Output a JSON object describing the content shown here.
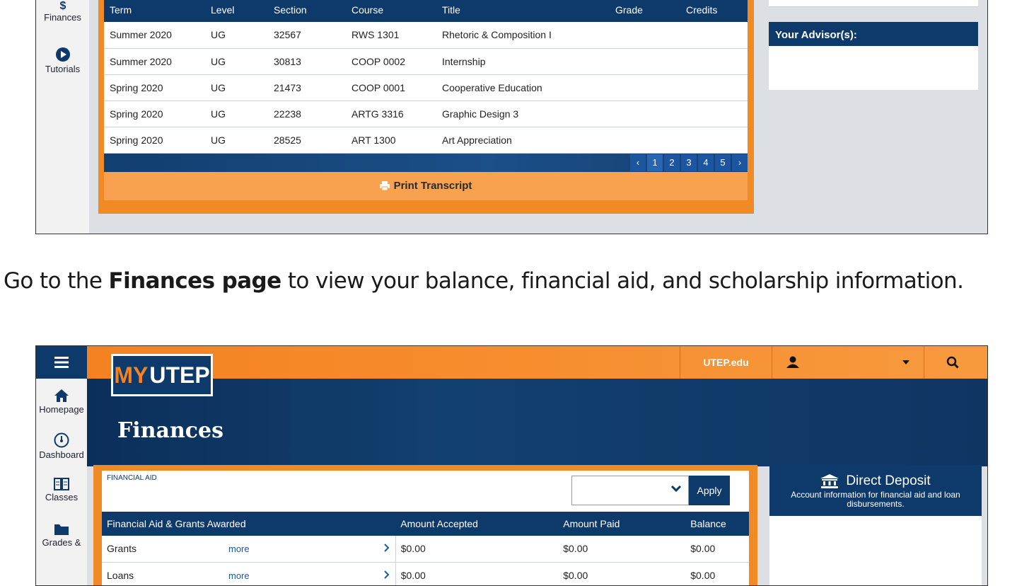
{
  "transcript_shot": {
    "rail": [
      {
        "label": "Finances",
        "icon": "dollar-icon"
      },
      {
        "label": "Tutorials",
        "icon": "play-icon"
      }
    ],
    "headers": [
      "Term",
      "Level",
      "Section",
      "Course",
      "Title",
      "Grade",
      "Credits"
    ],
    "rows": [
      [
        "Summer 2020",
        "UG",
        "32567",
        "RWS 1301",
        "Rhetoric & Composition I",
        "",
        ""
      ],
      [
        "Summer 2020",
        "UG",
        "30813",
        "COOP 0002",
        "Internship",
        "",
        ""
      ],
      [
        "Spring 2020",
        "UG",
        "21473",
        "COOP 0001",
        "Cooperative Education",
        "",
        ""
      ],
      [
        "Spring 2020",
        "UG",
        "22238",
        "ARTG 3316",
        "Graphic Design 3",
        "",
        ""
      ],
      [
        "Spring 2020",
        "UG",
        "28525",
        "ART 1300",
        "Art Appreciation",
        "",
        ""
      ]
    ],
    "pager": {
      "prev": "‹",
      "pages": [
        "1",
        "2",
        "3",
        "4",
        "5"
      ],
      "next": "›",
      "current": "1"
    },
    "print_label": "Print Transcript",
    "advisor_title": "Your Advisor(s):"
  },
  "caption": {
    "before": "Go to the ",
    "bold": "Finances page",
    "after": " to view your balance, financial aid, and scholarship information."
  },
  "finances_shot": {
    "logo": {
      "my": "MY",
      "utep": "UTEP"
    },
    "topbar": {
      "link": "UTEP.edu"
    },
    "sidebar": [
      {
        "label": "Homepage",
        "icon": "home-icon"
      },
      {
        "label": "Dashboard",
        "icon": "dashboard-icon"
      },
      {
        "label": "Classes",
        "icon": "book-icon"
      },
      {
        "label": "Grades &",
        "icon": "folder-icon"
      }
    ],
    "page_title": "Finances",
    "financial_aid": {
      "label": "FINANCIAL AID",
      "select_value": "",
      "apply_label": "Apply",
      "headers": [
        "Financial Aid & Grants Awarded",
        "Amount Accepted",
        "Amount Paid",
        "Balance"
      ],
      "rows": [
        {
          "name": "Grants",
          "more": "more",
          "accepted": "$0.00",
          "paid": "$0.00",
          "balance": "$0.00"
        },
        {
          "name": "Loans",
          "more": "more",
          "accepted": "$0.00",
          "paid": "$0.00",
          "balance": "$0.00"
        }
      ]
    },
    "direct_deposit": {
      "title": "Direct Deposit",
      "subtitle": "Account information for financial aid and loan disbursements."
    }
  },
  "colors": {
    "navy": "#0e3a6b",
    "orange": "#f08a24"
  }
}
